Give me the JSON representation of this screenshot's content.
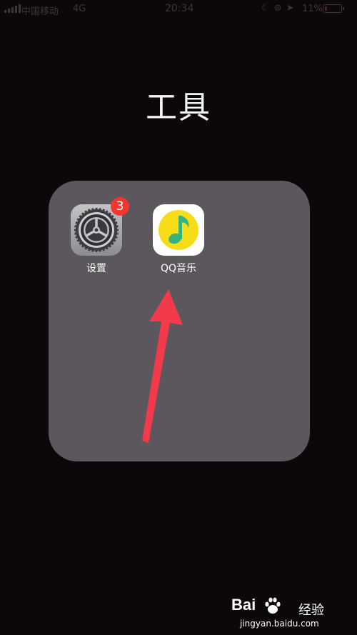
{
  "status_bar": {
    "carrier": "中国移动",
    "network": "4G",
    "time": "20:34",
    "icons": [
      "moon-icon",
      "rotation-lock-icon",
      "location-icon"
    ],
    "battery_percent": "11%",
    "battery_level": 0.11
  },
  "folder": {
    "title": "工具",
    "apps": [
      {
        "name": "设置",
        "icon": "settings-gear-icon",
        "badge": "3"
      },
      {
        "name": "QQ音乐",
        "icon": "qq-music-note-icon"
      }
    ]
  },
  "annotation": {
    "arrow_color": "#f23a4a",
    "points_to": "QQ音乐"
  },
  "watermark": {
    "brand": "Bai",
    "service": "经验",
    "url": "jingyan.baidu.com"
  },
  "colors": {
    "background": "#0b070a",
    "folder": "#5b575c",
    "badge": "#f1372e",
    "qq_yellow": "#f7dd17",
    "qq_green": "#35b27d"
  }
}
